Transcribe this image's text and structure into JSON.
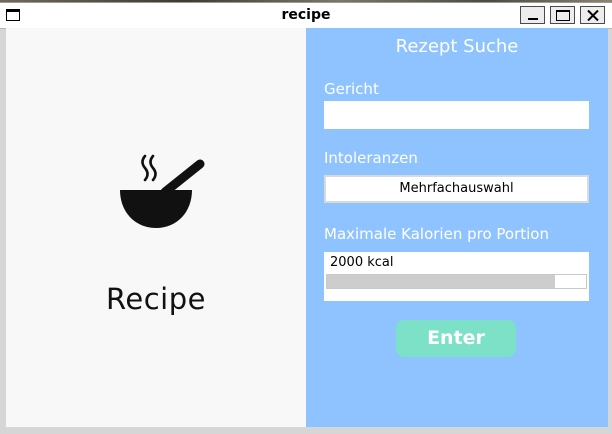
{
  "window": {
    "title": "recipe",
    "controls": {
      "minimize": "minimize-icon",
      "maximize": "maximize-icon",
      "close": "close-icon"
    }
  },
  "left": {
    "logo_icon": "bowl-with-spoon-icon",
    "brand": "Recipe"
  },
  "form": {
    "heading": "Rezept Suche",
    "dish_label": "Gericht",
    "dish_value": "",
    "intolerance_label": "Intoleranzen",
    "intolerance_select": "Mehrfachauswahl",
    "calories_label": "Maximale Kalorien pro Portion",
    "calories_value": "2000 kcal",
    "calories_slider_fraction": 0.88,
    "enter_label": "Enter"
  },
  "colors": {
    "form_background": "#8fc3ff",
    "enter_button": "#7de1c8",
    "left_background": "#f8f8f8"
  }
}
